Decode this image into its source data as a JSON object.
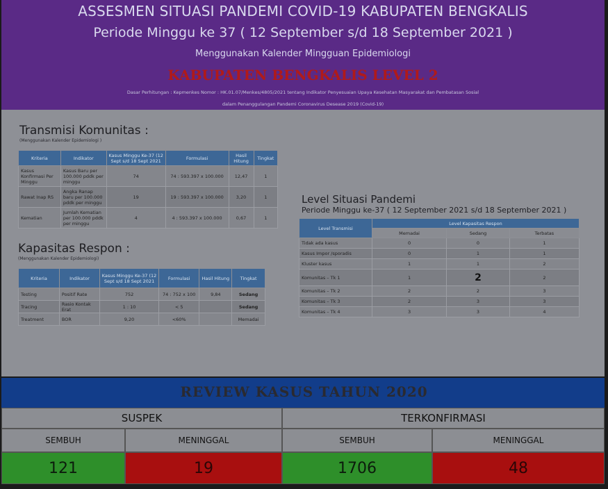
{
  "header": {
    "title": "ASSESMEN SITUASI PANDEMI COVID-19 KABUPATEN BENGKALIS",
    "period": "Periode Minggu ke 37 ( 12 September s/d 18 September 2021 )",
    "calendar": "Menggunakan Kalender Mingguan Epidemiologi",
    "level": "KABUPATEN BENGKALIS LEVEL 2",
    "basis_line1": "Dasar Perhitungan : Kepmenkes Nomor : HK.01.07/Menkes/4805/2021 tentang Indikator Penyesuaian Upaya Kesehatan Masyarakat dan Pembatasan Sosial",
    "basis_line2": "dalam Penanggulangan Pandemi Coronavirus Desease 2019 (Covid-19)"
  },
  "transmisi": {
    "title": "Transmisi Komunitas :",
    "subtitle": "(Menggunakan Kalender Epidemiologi )",
    "headers": [
      "Kriteria",
      "Indikator",
      "Kasus Minggu Ke-37 (12 Sept s/d 18 Sept 2021",
      "Formulasi",
      "Hasil Hitung",
      "Tingkat"
    ],
    "rows": [
      [
        "Kasus Konfirmasi Per Minggu",
        "Kasus Baru per 100.000 pddk per minggu",
        "74",
        "74 : 593.397 x 100.000",
        "12,47",
        "1"
      ],
      [
        "Rawat Inap RS",
        "Angka Ranap baru per 100.000 pddk per minggu",
        "19",
        "19 : 593.397 x 100.000",
        "3,20",
        "1"
      ],
      [
        "Kematian",
        "Jumlah Kematian per 100.000 pddk per minggu",
        "4",
        "4 : 593.397 x 100.000",
        "0,67",
        "1"
      ]
    ]
  },
  "kapasitas": {
    "title": "Kapasitas Respon :",
    "subtitle": "(Menggunakan Kalender Epidemiologi)",
    "headers": [
      "Kriteria",
      "Indikator",
      "Kasus Minggu Ke-37 (12 Sept s/d 18 Sept 2021",
      "Formulasi",
      "Hasil Hitung",
      "Tingkat"
    ],
    "rows": [
      [
        "Testing",
        "Positif Rate",
        "752",
        "74 : 752 x 100",
        "9,84",
        "Sedang"
      ],
      [
        "Tracing",
        "Rasio Kontak Erat",
        "1 : 10",
        "< 5",
        "",
        "Sedang"
      ],
      [
        "Treatment",
        "BOR",
        "9,20",
        "<60%",
        "",
        "Memadai"
      ]
    ]
  },
  "level_situasi": {
    "title": "Level Situasi Pandemi",
    "subtitle": "Periode Minggu ke-37 ( 12 September 2021 s/d 18 September 2021 )",
    "header_transmisi": "Level Transmisi",
    "header_kapasitas": "Level Kapasitas Respon",
    "columns": [
      "Memadai",
      "Sedang",
      "Terbatas"
    ],
    "rows": [
      {
        "label": "Tidak ada kasus",
        "values": [
          "0",
          "0",
          "1"
        ]
      },
      {
        "label": "Kasus Impor /sporadis",
        "values": [
          "0",
          "1",
          "1"
        ]
      },
      {
        "label": "Kluster kasus",
        "values": [
          "1",
          "1",
          "2"
        ]
      },
      {
        "label": "Komunitas – Tk 1",
        "values": [
          "1",
          "2",
          "2"
        ]
      },
      {
        "label": "Komunitas – Tk 2",
        "values": [
          "2",
          "2",
          "3"
        ]
      },
      {
        "label": "Komunitas – Tk 3",
        "values": [
          "2",
          "3",
          "3"
        ]
      },
      {
        "label": "Komunitas – Tk 4",
        "values": [
          "3",
          "3",
          "4"
        ]
      }
    ]
  },
  "review": {
    "title": "REVIEW KASUS TAHUN 2020",
    "suspek": "SUSPEK",
    "terkonfirmasi": "TERKONFIRMASI",
    "sembuh": "SEMBUH",
    "meninggal": "MENINGGAL",
    "suspek_sembuh": "121",
    "suspek_meninggal": "19",
    "konfirmasi_sembuh": "1706",
    "konfirmasi_meninggal": "48"
  },
  "colors": {
    "header_bg": "#5a2a86",
    "level_text": "#b01a1a",
    "table_header": "#3d6796",
    "review_band": "#123d8a",
    "sembuh_bg": "#2e8f2a",
    "meninggal_bg": "#a80f0f"
  }
}
